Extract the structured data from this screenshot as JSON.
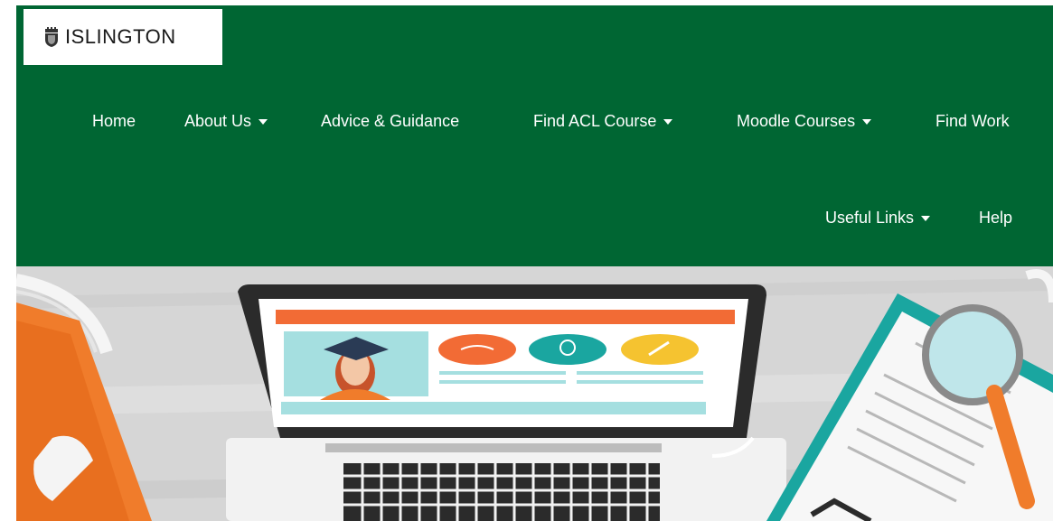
{
  "header": {
    "logo_text": "ISLINGTON",
    "bg_color": "#006633"
  },
  "nav": {
    "items": [
      {
        "label": "Home",
        "dropdown": false
      },
      {
        "label": "About Us",
        "dropdown": true
      },
      {
        "label": "Advice & Guidance",
        "dropdown": false
      },
      {
        "label": "Find ACL Course",
        "dropdown": true
      },
      {
        "label": "Moodle Courses",
        "dropdown": true
      },
      {
        "label": "Find Work",
        "dropdown": false
      },
      {
        "label": "Useful Links",
        "dropdown": true
      },
      {
        "label": "Help",
        "dropdown": false
      }
    ]
  },
  "hero": {
    "colors": {
      "desk": "#d9d9d9",
      "laptop": "#2b2b2b",
      "banner": "#f26b35",
      "teal": "#1aa6a0",
      "yellow": "#f5c330",
      "orange": "#f07c2b"
    }
  }
}
